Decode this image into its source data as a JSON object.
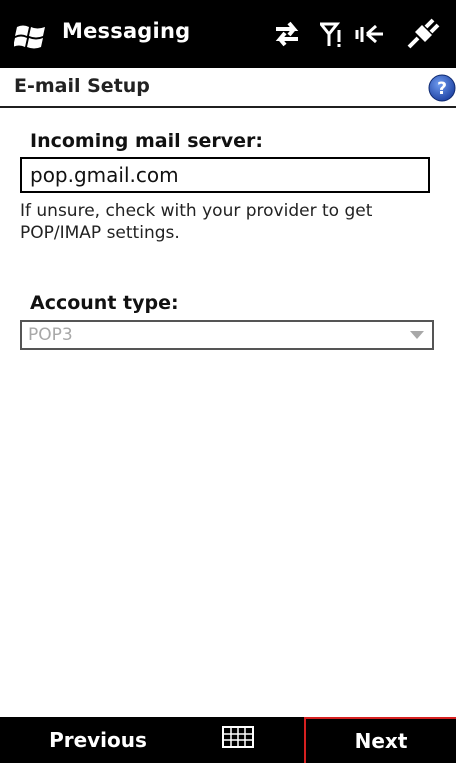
{
  "titlebar": {
    "app_name": "Messaging",
    "icons": [
      "windows-start-icon",
      "sync-arrows-icon",
      "signal-icon",
      "volume-icon",
      "power-plug-icon"
    ]
  },
  "header": {
    "title": "E-mail Setup",
    "help_icon": "help-icon"
  },
  "form": {
    "server_label": "Incoming mail server:",
    "server_value": "pop.gmail.com",
    "hint": "If unsure, check with your provider to get POP/IMAP settings.",
    "account_type_label": "Account type:",
    "account_type_value": "POP3"
  },
  "softkeys": {
    "left_label": "Previous",
    "right_label": "Next",
    "center_icon": "keyboard-icon"
  },
  "colors": {
    "titlebar_bg": "#000000",
    "next_highlight": "#d62020",
    "help_blue": "#2a5bd0"
  }
}
